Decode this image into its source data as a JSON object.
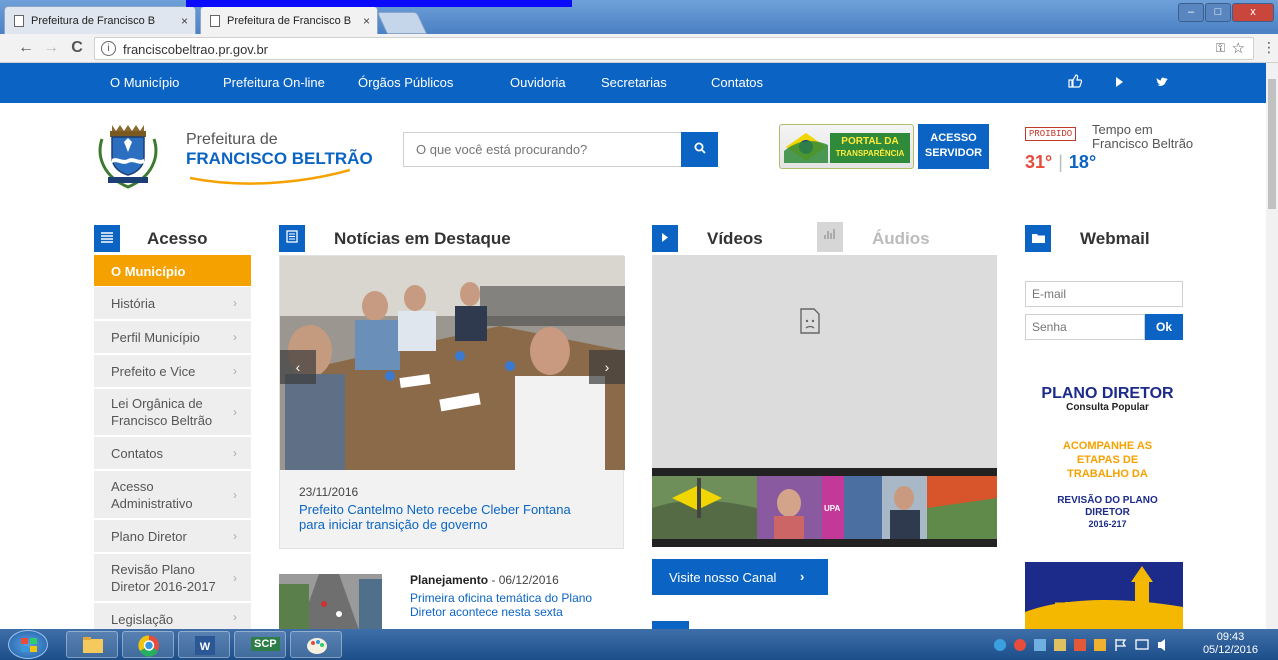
{
  "browser": {
    "tabs": [
      {
        "title": "Prefeitura de Francisco B"
      },
      {
        "title": "Prefeitura de Francisco B"
      }
    ],
    "tab_close": "×",
    "url": "franciscobeltrao.pr.gov.br",
    "back": "←",
    "forward": "→",
    "reload": "C",
    "info": "i",
    "key_icon": "⚿",
    "star_icon": "☆",
    "menu_icon": "⋮",
    "win_min": "–",
    "win_max": "□",
    "win_close": "x"
  },
  "nav": {
    "items": [
      "O Município",
      "Prefeitura On-line",
      "Órgãos Públicos",
      "Ouvidoria",
      "Secretarias",
      "Contatos"
    ],
    "social": [
      "thumbs-up-icon",
      "play-icon",
      "twitter-icon"
    ]
  },
  "header": {
    "logo_line1": "Prefeitura de",
    "logo_line2": "FRANCISCO BELTRÃO",
    "search_placeholder": "O que você está procurando?",
    "transparencia_l1": "PORTAL DA",
    "transparencia_l2": "TRANSPARÊNCIA",
    "acesso_l1": "ACESSO",
    "acesso_l2": "SERVIDOR",
    "proibido": "PROIBIDO",
    "tempo_l1": "Tempo em",
    "tempo_l2": "Francisco Beltrão",
    "temp_max": "31°",
    "temp_sep": "|",
    "temp_min": "18°"
  },
  "sections": {
    "acesso": "Acesso",
    "noticias": "Notícias em Destaque",
    "videos": "Vídeos",
    "audios": "Áudios",
    "webmail": "Webmail"
  },
  "sidebar": {
    "active": "O Município",
    "items": [
      "História",
      "Perfil Município",
      "Prefeito e Vice",
      "Lei Orgânica de Francisco Beltrão",
      "Contatos",
      "Acesso Administrativo",
      "Plano Diretor",
      "Revisão Plano Diretor 2016-2017",
      "Legislação"
    ]
  },
  "news": {
    "main_date": "23/11/2016",
    "main_headline": "Prefeito Cantelmo Neto recebe Cleber Fontana para iniciar transição de governo",
    "second_category": "Planejamento",
    "second_date": " - 06/12/2016",
    "second_headline": "Primeira oficina temática do Plano Diretor acontece nesta sexta"
  },
  "videos": {
    "canal_button": "Visite nosso Canal",
    "strip_tag": "UPA"
  },
  "webmail": {
    "email_placeholder": "E-mail",
    "senha_placeholder": "Senha",
    "ok": "Ok"
  },
  "plano_banner": {
    "title": "PLANO DIRETOR",
    "subtitle": "Consulta Popular",
    "acompanhe": "ACOMPANHE AS ETAPAS DE TRABALHO DA",
    "revisao": "REVISÃO DO PLANO DIRETOR",
    "years": "2016-217"
  },
  "taskbar": {
    "time": "09:43",
    "date": "05/12/2016",
    "scp_label": "SCP"
  },
  "colors": {
    "primary": "#0b64c4",
    "accent": "#f5a100",
    "temp_max": "#e74c3c"
  }
}
